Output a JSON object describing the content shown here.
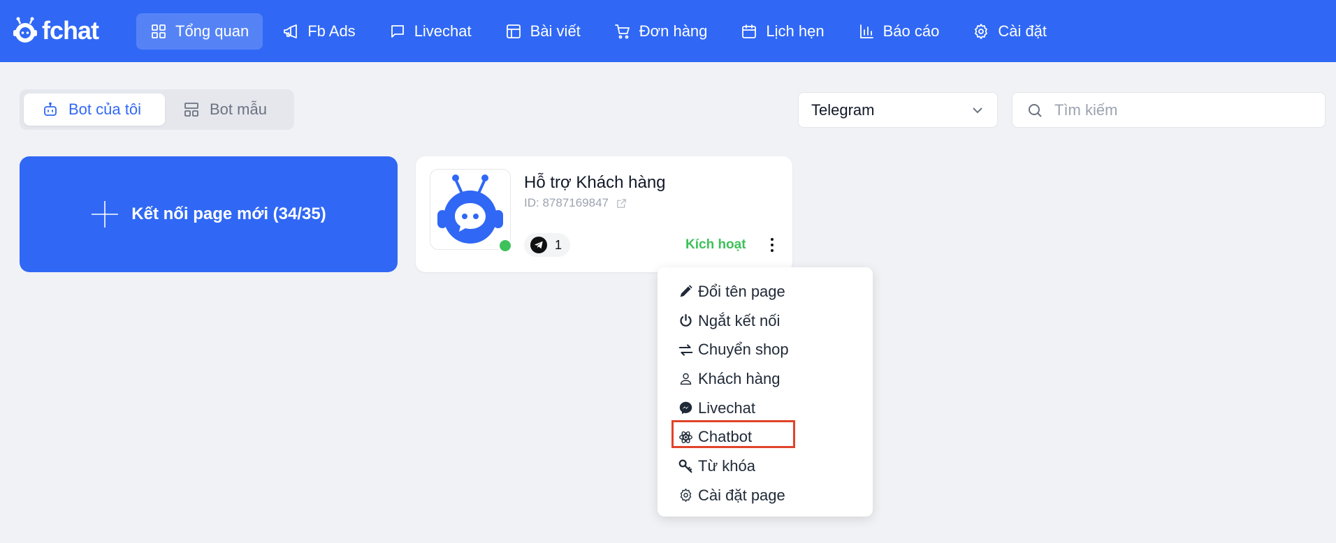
{
  "brand": {
    "name": "fchat"
  },
  "nav": {
    "items": [
      {
        "label": "Tổng quan",
        "icon": "grid-icon",
        "active": true
      },
      {
        "label": "Fb Ads",
        "icon": "megaphone-icon"
      },
      {
        "label": "Livechat",
        "icon": "chat-bubble-icon"
      },
      {
        "label": "Bài viết",
        "icon": "layout-icon"
      },
      {
        "label": "Đơn hàng",
        "icon": "cart-icon"
      },
      {
        "label": "Lịch hẹn",
        "icon": "calendar-icon"
      },
      {
        "label": "Báo cáo",
        "icon": "bar-chart-icon"
      },
      {
        "label": "Cài đặt",
        "icon": "gear-icon"
      }
    ]
  },
  "tabs": {
    "my_bots": "Bot của tôi",
    "template_bots": "Bot mẫu"
  },
  "filter": {
    "platform_selected": "Telegram",
    "search_placeholder": "Tìm kiếm"
  },
  "new_page": {
    "label": "Kết nối page mới (34/35)"
  },
  "bot": {
    "name": "Hỗ trợ Khách hàng",
    "id_text": "ID: 8787169847",
    "channel_count": "1",
    "status": "Kích hoạt"
  },
  "menu": {
    "items": [
      {
        "label": "Đổi tên page",
        "icon": "pencil-icon"
      },
      {
        "label": "Ngắt kết nối",
        "icon": "power-icon"
      },
      {
        "label": "Chuyển shop",
        "icon": "swap-arrows-icon"
      },
      {
        "label": "Khách hàng",
        "icon": "user-icon"
      },
      {
        "label": "Livechat",
        "icon": "messenger-icon"
      },
      {
        "label": "Chatbot",
        "icon": "atom-icon"
      },
      {
        "label": "Từ khóa",
        "icon": "key-icon"
      },
      {
        "label": "Cài đặt page",
        "icon": "gear-icon"
      }
    ]
  },
  "colors": {
    "primary": "#3068f5",
    "success": "#3ec15a",
    "highlight": "#e0442a",
    "background": "#f1f2f6"
  }
}
